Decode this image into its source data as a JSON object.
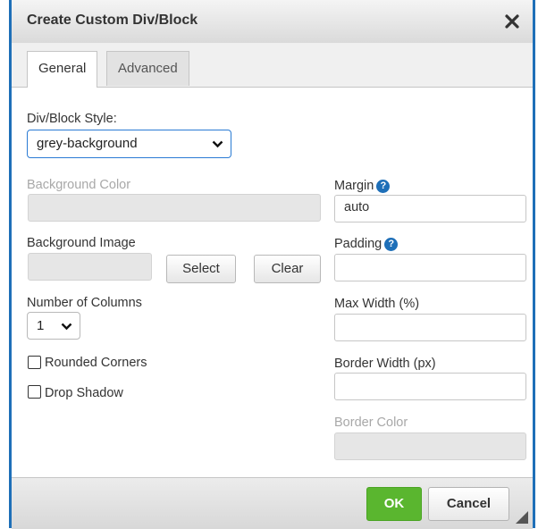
{
  "dialog": {
    "title": "Create Custom Div/Block",
    "close_icon": "close-icon",
    "accent_color": "#1e6fb8"
  },
  "tabs": [
    {
      "label": "General",
      "active": true
    },
    {
      "label": "Advanced",
      "active": false
    }
  ],
  "general": {
    "style_label": "Div/Block Style:",
    "style_value": "grey-background",
    "bg_color_label": "Background Color",
    "bg_color_value": "",
    "bg_image_label": "Background Image",
    "bg_image_value": "",
    "select_label": "Select",
    "clear_label": "Clear",
    "columns_label": "Number of Columns",
    "columns_value": "1",
    "rounded_label": "Rounded Corners",
    "rounded_checked": false,
    "shadow_label": "Drop Shadow",
    "shadow_checked": false,
    "margin_label": "Margin",
    "margin_value": "auto",
    "padding_label": "Padding",
    "padding_value": "",
    "max_width_label": "Max Width (%)",
    "max_width_value": "",
    "border_width_label": "Border Width (px)",
    "border_width_value": "",
    "border_color_label": "Border Color",
    "border_color_value": "",
    "help_icon": "help-icon"
  },
  "footer": {
    "ok_label": "OK",
    "cancel_label": "Cancel",
    "ok_color": "#5ab62f"
  }
}
